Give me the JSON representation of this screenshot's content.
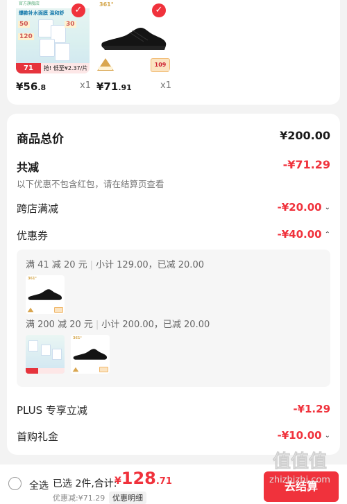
{
  "products": [
    {
      "name": "product-moisturizing-mask",
      "price_main": "¥56",
      "price_dec": ".8",
      "qty": "x1",
      "image": {
        "store": "官方旗舰店",
        "slogan": "爆款补水面膜 温和舒",
        "pack1": "50",
        "pack2": "120",
        "pack3": "30",
        "tag_price": "71",
        "tag_text": "抢! 低至¥2.37/片"
      }
    },
    {
      "name": "product-361-shoe",
      "price_main": "¥71",
      "price_dec": ".91",
      "qty": "x1",
      "image": {
        "brand": "361°",
        "tag_price": "109"
      }
    }
  ],
  "summary": {
    "total_label": "商品总价",
    "total_value": "¥200.00",
    "reduce_label": "共减",
    "reduce_value": "-¥71.29",
    "reduce_note": "以下优惠不包含红包，请在结算页查看",
    "cross_store_label": "跨店满减",
    "cross_store_value": "-¥20.00",
    "coupon_label": "优惠券",
    "coupon_value": "-¥40.00",
    "coupon_details": [
      {
        "rule": "满 41 减 20 元",
        "subtotal": "小计 129.00，已减 20.00"
      },
      {
        "rule": "满 200 减 20 元",
        "subtotal": "小计 200.00，已减 20.00"
      }
    ],
    "plus_label": "PLUS 专享立减",
    "plus_value": "-¥1.29",
    "first_buy_label": "首购礼金",
    "first_buy_value": "-¥10.00"
  },
  "bottom_bar": {
    "select_all": "全选",
    "selected": "已选 2件,合计:",
    "currency": "¥",
    "total_int": "128",
    "total_dec": ".71",
    "discount_text": "优惠减:¥71.29",
    "detail_button": "优惠明细",
    "pay_button": "去结算"
  },
  "watermark": "值值值 zhizhizhi.com",
  "colors": {
    "accent": "#f0323c",
    "background": "#f3f3f3"
  },
  "icons": {
    "check": "check-icon",
    "chevron_down": "chevron-down-icon",
    "chevron_up": "chevron-up-icon",
    "radio": "radio-icon"
  }
}
